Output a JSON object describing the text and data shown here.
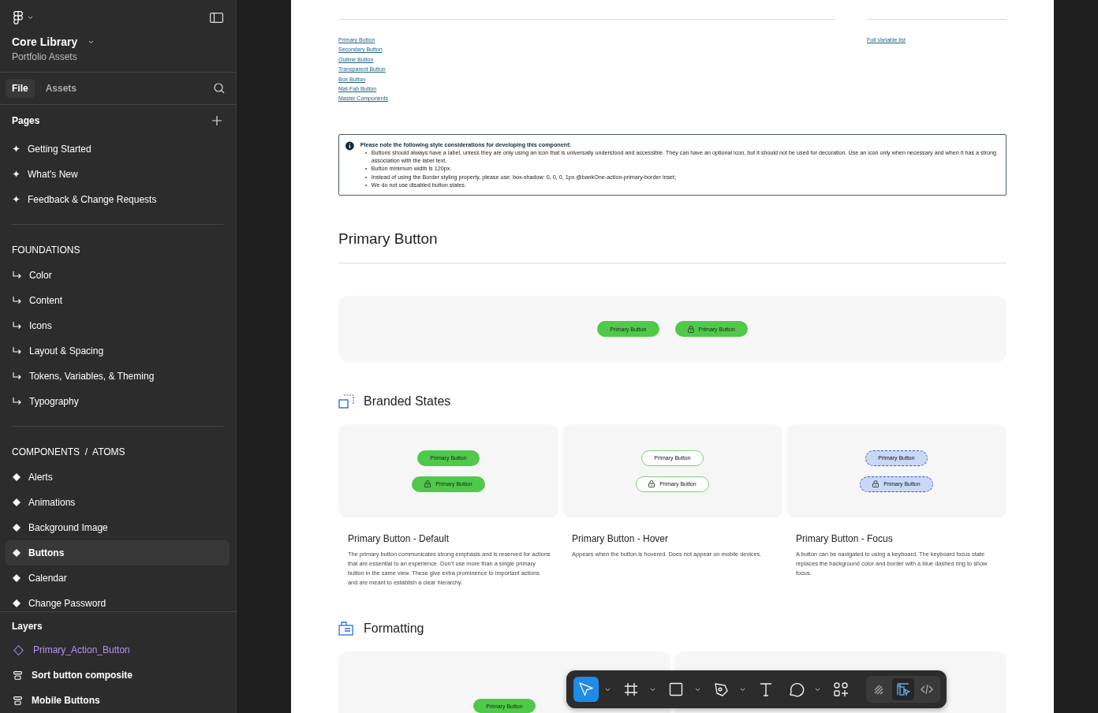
{
  "sidebar": {
    "file_title": "Core Library",
    "project": "Portfolio Assets",
    "tabs": [
      {
        "label": "File",
        "selected": true
      },
      {
        "label": "Assets",
        "selected": false
      }
    ],
    "pages_heading": "Pages",
    "pages": [
      "Getting Started",
      "What's New",
      "Feedback & Change Requests"
    ],
    "sections": [
      {
        "heading": "FOUNDATIONS",
        "kind": "foundation",
        "items": [
          {
            "label": "Color",
            "selected": false
          },
          {
            "label": "Content",
            "selected": false
          },
          {
            "label": "Icons",
            "selected": false
          },
          {
            "label": "Layout & Spacing",
            "selected": false
          },
          {
            "label": "Tokens, Variables, & Theming",
            "selected": false
          },
          {
            "label": "Typography",
            "selected": false
          }
        ]
      },
      {
        "heading": "COMPONENTS  /  ATOMS",
        "kind": "component",
        "items": [
          {
            "label": "Alerts",
            "selected": false
          },
          {
            "label": "Animations",
            "selected": false
          },
          {
            "label": "Background Image",
            "selected": false
          },
          {
            "label": "Buttons",
            "selected": true
          },
          {
            "label": "Calendar",
            "selected": false
          },
          {
            "label": "Change Password",
            "selected": false
          }
        ]
      }
    ],
    "layers_heading": "Layers",
    "layers": [
      {
        "label": "Primary_Action_Button",
        "kind": "component"
      },
      {
        "label": "Sort button composite",
        "kind": "frame"
      },
      {
        "label": "Mobile Buttons",
        "kind": "frame"
      }
    ]
  },
  "document": {
    "toc_links": [
      "Primary Button",
      "Secondary Button",
      "Outline Button",
      "Transparent Button",
      "Box Button",
      "Mat-Fab Button",
      "Master Components"
    ],
    "related_links": [
      "Full Variable list"
    ],
    "note": {
      "title": "Please note the following style considerations for developing this component:",
      "bullets": [
        "Buttons should always have a label, unless they are only using an icon that is universally understood and accessible. They can have an optional icon, but it should not be used for decoration. Use an icon only when necessary and when it has a strong association with the label text.",
        "Button minimum width is 120px.",
        "Instead of using the Border styling property, please use: box-shadow: 0, 0, 0, 1px @bankOne-action-primary-border inset;",
        "We do not use disabled button states."
      ]
    },
    "section_title": "Primary Button",
    "hero_buttons": [
      {
        "label": "Primary Button",
        "lock": false
      },
      {
        "label": "Primary Button",
        "lock": true
      }
    ],
    "branded_states": {
      "title": "Branded States",
      "states": [
        {
          "kind": "default",
          "buttons": [
            {
              "label": "Primary Button",
              "lock": false
            },
            {
              "label": "Primary Button",
              "lock": true
            }
          ],
          "title": "Primary Button - Default",
          "description": "The primary button communicates strong emphasis and is reserved for actions that are essential to an experience. Don’t use more than a single primary button in the same view. These give extra prominence to important actions and are meant to establish a clear hierarchy."
        },
        {
          "kind": "hover",
          "buttons": [
            {
              "label": "Primary Button",
              "lock": false
            },
            {
              "label": "Primary Button",
              "lock": true
            }
          ],
          "title": "Primary Button - Hover",
          "description": "Appears when the button is hovered. Does not appear on mobile devices."
        },
        {
          "kind": "focus",
          "buttons": [
            {
              "label": "Primary Button",
              "lock": false
            },
            {
              "label": "Primary Button",
              "lock": true
            }
          ],
          "title": "Primary Button - Focus",
          "description": "A button can be navigated to using a keyboard. The keyboard focus state replaces the background color and border with a blue dashed ring to show focus."
        }
      ]
    },
    "formatting": {
      "title": "Formatting",
      "buttons": [
        "Primary Button"
      ]
    }
  },
  "toolbar": {
    "tools": [
      {
        "kind": "move",
        "selected": true,
        "dropdown": true
      },
      {
        "kind": "frame",
        "selected": false,
        "dropdown": true
      },
      {
        "kind": "shape",
        "selected": false,
        "dropdown": true
      },
      {
        "kind": "pen",
        "selected": false,
        "dropdown": true
      },
      {
        "kind": "text",
        "selected": false,
        "dropdown": false
      },
      {
        "kind": "comment",
        "selected": false,
        "dropdown": true
      },
      {
        "kind": "actions",
        "selected": false,
        "dropdown": false
      }
    ],
    "modes": [
      {
        "kind": "draw",
        "selected": false
      },
      {
        "kind": "design",
        "selected": true
      },
      {
        "kind": "dev",
        "selected": false
      }
    ]
  }
}
